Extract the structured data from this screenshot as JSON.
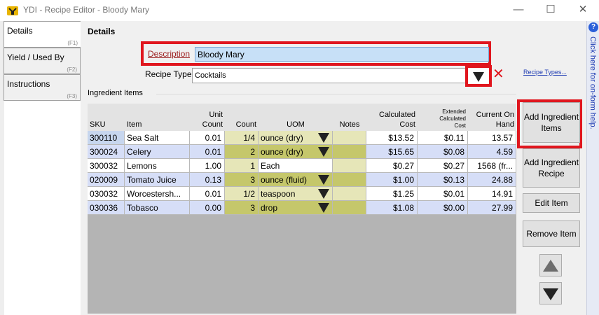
{
  "window": {
    "title": "YDI - Recipe Editor - Bloody Mary",
    "minimize": "—",
    "maximize": "☐",
    "close": "✕"
  },
  "tabs": [
    {
      "label": "Details",
      "key": "(F1)"
    },
    {
      "label": "Yield / Used By",
      "key": "(F2)"
    },
    {
      "label": "Instructions",
      "key": "(F3)"
    }
  ],
  "details": {
    "heading": "Details",
    "description_label": "Description",
    "description_value": "Bloody Mary",
    "recipe_type_label": "Recipe Type",
    "recipe_type_value": "Cocktails",
    "recipe_types_link": "Recipe Types...",
    "ingredient_items_label": "Ingredient Items"
  },
  "grid": {
    "headers": {
      "sku": "SKU",
      "item": "Item",
      "unit_count": "Unit\nCount",
      "count": "Count",
      "uom": "UOM",
      "notes": "Notes",
      "calc_cost": "Calculated\nCost",
      "ext_cost": "Extended\nCalculated\nCost",
      "on_hand": "Current On\nHand"
    },
    "rows": [
      {
        "sku": "300110",
        "item": "Sea Salt",
        "unit_count": "0.01",
        "count": "1/4",
        "uom": "ounce (dry)",
        "uom_dropdown": true,
        "notes": "",
        "calc_cost": "$13.52",
        "ext_cost": "$0.11",
        "on_hand": "13.57"
      },
      {
        "sku": "300024",
        "item": "Celery",
        "unit_count": "0.01",
        "count": "2",
        "uom": "ounce (dry)",
        "uom_dropdown": true,
        "notes": "",
        "calc_cost": "$15.65",
        "ext_cost": "$0.08",
        "on_hand": "4.59"
      },
      {
        "sku": "300032",
        "item": "Lemons",
        "unit_count": "1.00",
        "count": "1",
        "uom": "Each",
        "uom_dropdown": false,
        "notes": "",
        "calc_cost": "$0.27",
        "ext_cost": "$0.27",
        "on_hand": "1568 (fr..."
      },
      {
        "sku": "020009",
        "item": "Tomato Juice",
        "unit_count": "0.13",
        "count": "3",
        "uom": "ounce (fluid)",
        "uom_dropdown": true,
        "notes": "",
        "calc_cost": "$1.00",
        "ext_cost": "$0.13",
        "on_hand": "24.88"
      },
      {
        "sku": "030032",
        "item": "Worcestersh...",
        "unit_count": "0.01",
        "count": "1/2",
        "uom": "teaspoon",
        "uom_dropdown": true,
        "notes": "",
        "calc_cost": "$1.25",
        "ext_cost": "$0.01",
        "on_hand": "14.91"
      },
      {
        "sku": "030036",
        "item": "Tobasco",
        "unit_count": "0.00",
        "count": "3",
        "uom": "drop",
        "uom_dropdown": true,
        "notes": "",
        "calc_cost": "$1.08",
        "ext_cost": "$0.00",
        "on_hand": "27.99"
      }
    ]
  },
  "buttons": {
    "add_items": "Add Ingredient Items",
    "add_recipe": "Add Ingredient Recipe",
    "edit_item": "Edit Item",
    "remove_item": "Remove Item"
  },
  "help": {
    "icon": "?",
    "text": "Click here for on-form help."
  },
  "colors": {
    "highlight_red": "#e0161e",
    "row_blue": "#d6def7",
    "count_yellow": "#e6e6b8",
    "uom_olive": "#c5c76b",
    "selected_input": "#c7e0f7"
  }
}
